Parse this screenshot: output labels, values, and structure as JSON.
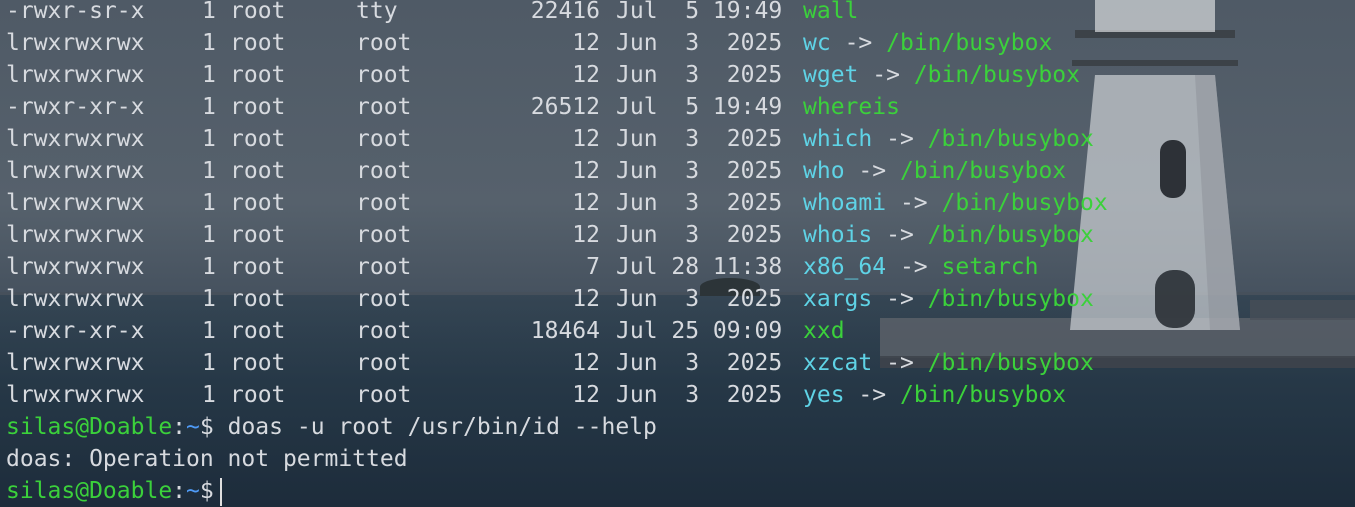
{
  "terminal": {
    "listing": [
      {
        "perm": "-rwxr-sr-x",
        "links": "1",
        "owner": "root",
        "group": "tty",
        "size": "22416",
        "date": "Jul  5 19:49",
        "name": "wall",
        "type": "exe"
      },
      {
        "perm": "lrwxrwxrwx",
        "links": "1",
        "owner": "root",
        "group": "root",
        "size": "12",
        "date": "Jun  3  2025",
        "name": "wc",
        "type": "link",
        "arrow": "->",
        "target": "/bin/busybox"
      },
      {
        "perm": "lrwxrwxrwx",
        "links": "1",
        "owner": "root",
        "group": "root",
        "size": "12",
        "date": "Jun  3  2025",
        "name": "wget",
        "type": "link",
        "arrow": "->",
        "target": "/bin/busybox"
      },
      {
        "perm": "-rwxr-xr-x",
        "links": "1",
        "owner": "root",
        "group": "root",
        "size": "26512",
        "date": "Jul  5 19:49",
        "name": "whereis",
        "type": "exe"
      },
      {
        "perm": "lrwxrwxrwx",
        "links": "1",
        "owner": "root",
        "group": "root",
        "size": "12",
        "date": "Jun  3  2025",
        "name": "which",
        "type": "link",
        "arrow": "->",
        "target": "/bin/busybox"
      },
      {
        "perm": "lrwxrwxrwx",
        "links": "1",
        "owner": "root",
        "group": "root",
        "size": "12",
        "date": "Jun  3  2025",
        "name": "who",
        "type": "link",
        "arrow": "->",
        "target": "/bin/busybox"
      },
      {
        "perm": "lrwxrwxrwx",
        "links": "1",
        "owner": "root",
        "group": "root",
        "size": "12",
        "date": "Jun  3  2025",
        "name": "whoami",
        "type": "link",
        "arrow": "->",
        "target": "/bin/busybox"
      },
      {
        "perm": "lrwxrwxrwx",
        "links": "1",
        "owner": "root",
        "group": "root",
        "size": "12",
        "date": "Jun  3  2025",
        "name": "whois",
        "type": "link",
        "arrow": "->",
        "target": "/bin/busybox"
      },
      {
        "perm": "lrwxrwxrwx",
        "links": "1",
        "owner": "root",
        "group": "root",
        "size": "7",
        "date": "Jul 28 11:38",
        "name": "x86_64",
        "type": "link",
        "arrow": "->",
        "target": "setarch"
      },
      {
        "perm": "lrwxrwxrwx",
        "links": "1",
        "owner": "root",
        "group": "root",
        "size": "12",
        "date": "Jun  3  2025",
        "name": "xargs",
        "type": "link",
        "arrow": "->",
        "target": "/bin/busybox"
      },
      {
        "perm": "-rwxr-xr-x",
        "links": "1",
        "owner": "root",
        "group": "root",
        "size": "18464",
        "date": "Jul 25 09:09",
        "name": "xxd",
        "type": "exe"
      },
      {
        "perm": "lrwxrwxrwx",
        "links": "1",
        "owner": "root",
        "group": "root",
        "size": "12",
        "date": "Jun  3  2025",
        "name": "xzcat",
        "type": "link",
        "arrow": "->",
        "target": "/bin/busybox"
      },
      {
        "perm": "lrwxrwxrwx",
        "links": "1",
        "owner": "root",
        "group": "root",
        "size": "12",
        "date": "Jun  3  2025",
        "name": "yes",
        "type": "link",
        "arrow": "->",
        "target": "/bin/busybox"
      }
    ],
    "prompt": {
      "user_host": "silas@Doable",
      "colon": ":",
      "cwd": "~",
      "symbol": "$"
    },
    "command": "doas -u root /usr/bin/id --help",
    "output": "doas: Operation not permitted"
  },
  "colors": {
    "executable": "#3bd13b",
    "symlink": "#5fd3e6",
    "link_target": "#3bd13b",
    "prompt_user": "#3bd13b",
    "prompt_path": "#4f9bf6",
    "text": "#d7dadf"
  }
}
